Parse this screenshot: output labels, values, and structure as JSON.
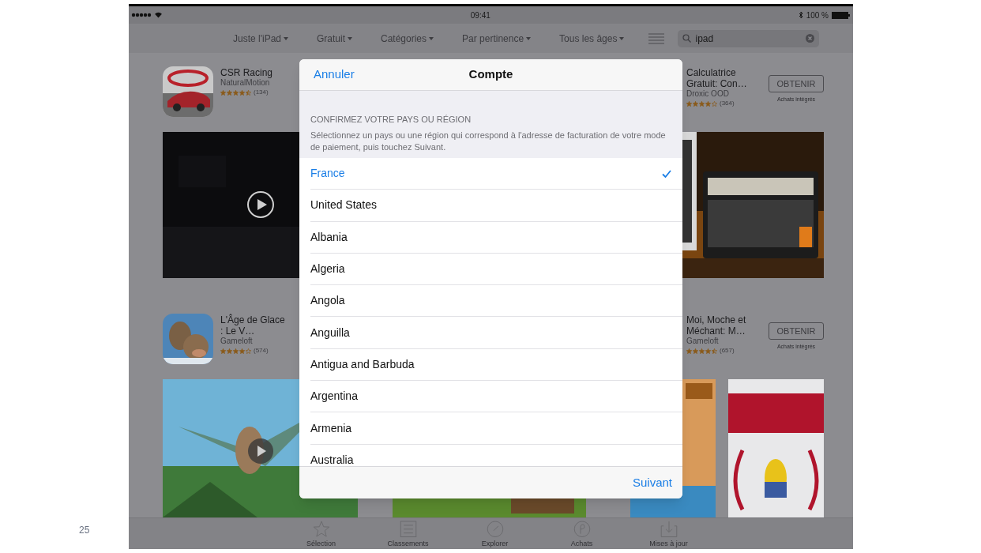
{
  "slide_number": "25",
  "status_bar": {
    "time": "09:41",
    "battery": "100 %"
  },
  "filters": [
    {
      "label": "Juste l'iPad"
    },
    {
      "label": "Gratuit"
    },
    {
      "label": "Catégories"
    },
    {
      "label": "Par pertinence"
    },
    {
      "label": "Tous les âges"
    }
  ],
  "search": {
    "value": "ipad"
  },
  "apps": [
    {
      "title": "CSR Racing",
      "developer": "NaturalMotion",
      "stars": 4.5,
      "reviews": "(134)"
    },
    {
      "title": "Calculatrice Gratuit: Con…",
      "developer": "Droxic OOD",
      "stars": 4,
      "reviews": "(364)",
      "button": "OBTENIR",
      "note": "Achats intégrés"
    },
    {
      "title": "L'Âge de Glace : Le V…",
      "developer": "Gameloft",
      "stars": 4,
      "reviews": "(574)"
    },
    {
      "title": "Moi, Moche et Méchant: M…",
      "developer": "Gameloft",
      "stars": 4.5,
      "reviews": "(657)",
      "button": "OBTENIR",
      "note": "Achats intégrés"
    }
  ],
  "dialog": {
    "cancel": "Annuler",
    "title": "Compte",
    "section_title": "CONFIRMEZ VOTRE PAYS OU RÉGION",
    "description": "Sélectionnez un pays ou une région qui correspond à l'adresse de facturation de votre mode de paiement, puis touchez Suivant.",
    "countries": [
      {
        "name": "France",
        "selected": true
      },
      {
        "name": "United States",
        "selected": false
      },
      {
        "name": "Albania",
        "selected": false
      },
      {
        "name": "Algeria",
        "selected": false
      },
      {
        "name": "Angola",
        "selected": false
      },
      {
        "name": "Anguilla",
        "selected": false
      },
      {
        "name": "Antigua and Barbuda",
        "selected": false
      },
      {
        "name": "Argentina",
        "selected": false
      },
      {
        "name": "Armenia",
        "selected": false
      },
      {
        "name": "Australia",
        "selected": false
      }
    ],
    "next": "Suivant"
  },
  "tab_bar": [
    {
      "label": "Sélection"
    },
    {
      "label": "Classements"
    },
    {
      "label": "Explorer"
    },
    {
      "label": "Achats"
    },
    {
      "label": "Mises à jour"
    }
  ]
}
